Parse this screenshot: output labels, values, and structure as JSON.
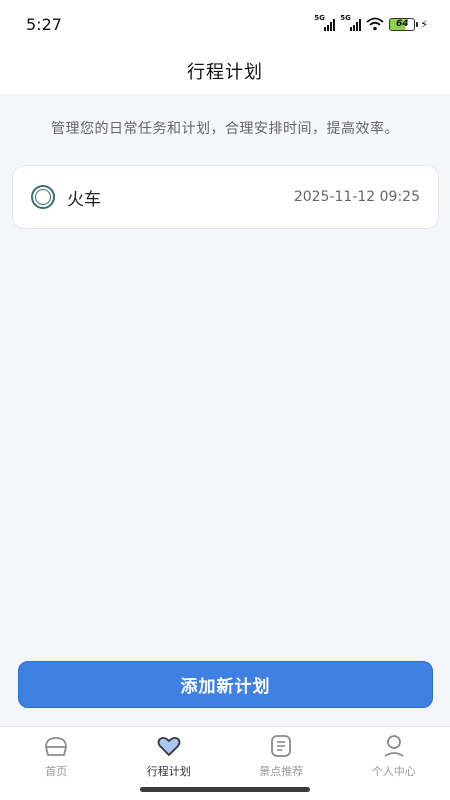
{
  "status_bar": {
    "time": "5:27",
    "network_1": "5G",
    "network_2": "5G",
    "battery": "64"
  },
  "header": {
    "title": "行程计划"
  },
  "description": "管理您的日常任务和计划，合理安排时间，提高效率。",
  "plans": [
    {
      "title": "火车",
      "time": "2025-11-12 09:25"
    }
  ],
  "add_button": {
    "label": "添加新计划"
  },
  "tabbar": {
    "items": [
      {
        "label": "首页",
        "icon": "home-icon"
      },
      {
        "label": "行程计划",
        "icon": "heart-icon",
        "active": true
      },
      {
        "label": "景点推荐",
        "icon": "list-icon"
      },
      {
        "label": "个人中心",
        "icon": "user-icon"
      }
    ]
  },
  "colors": {
    "accent": "#3f80e3",
    "active_icon": "#a9c9f5",
    "radio": "#3b6d72"
  }
}
